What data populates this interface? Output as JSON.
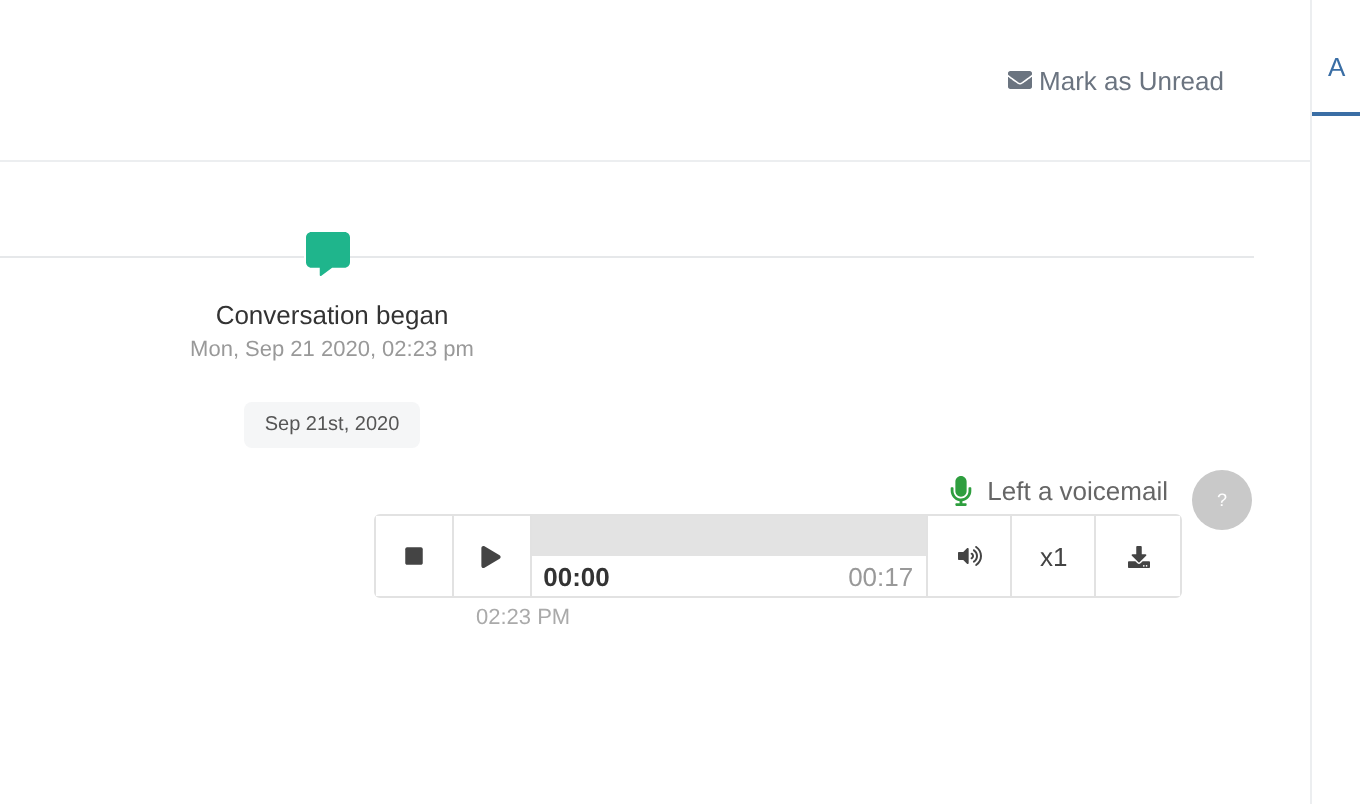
{
  "header": {
    "mark_unread": "Mark as Unread"
  },
  "side_tabs": [
    {
      "label": "A",
      "selected": true
    }
  ],
  "event": {
    "title": "Conversation began",
    "time": "Mon, Sep 21 2020, 02:23 pm"
  },
  "date_pill": "Sep 21st, 2020",
  "voicemail": {
    "label": "Left a voicemail",
    "avatar": "?",
    "player": {
      "current": "00:00",
      "duration": "00:17",
      "level": 0,
      "speed": "x1"
    },
    "time": "02:23 PM"
  }
}
